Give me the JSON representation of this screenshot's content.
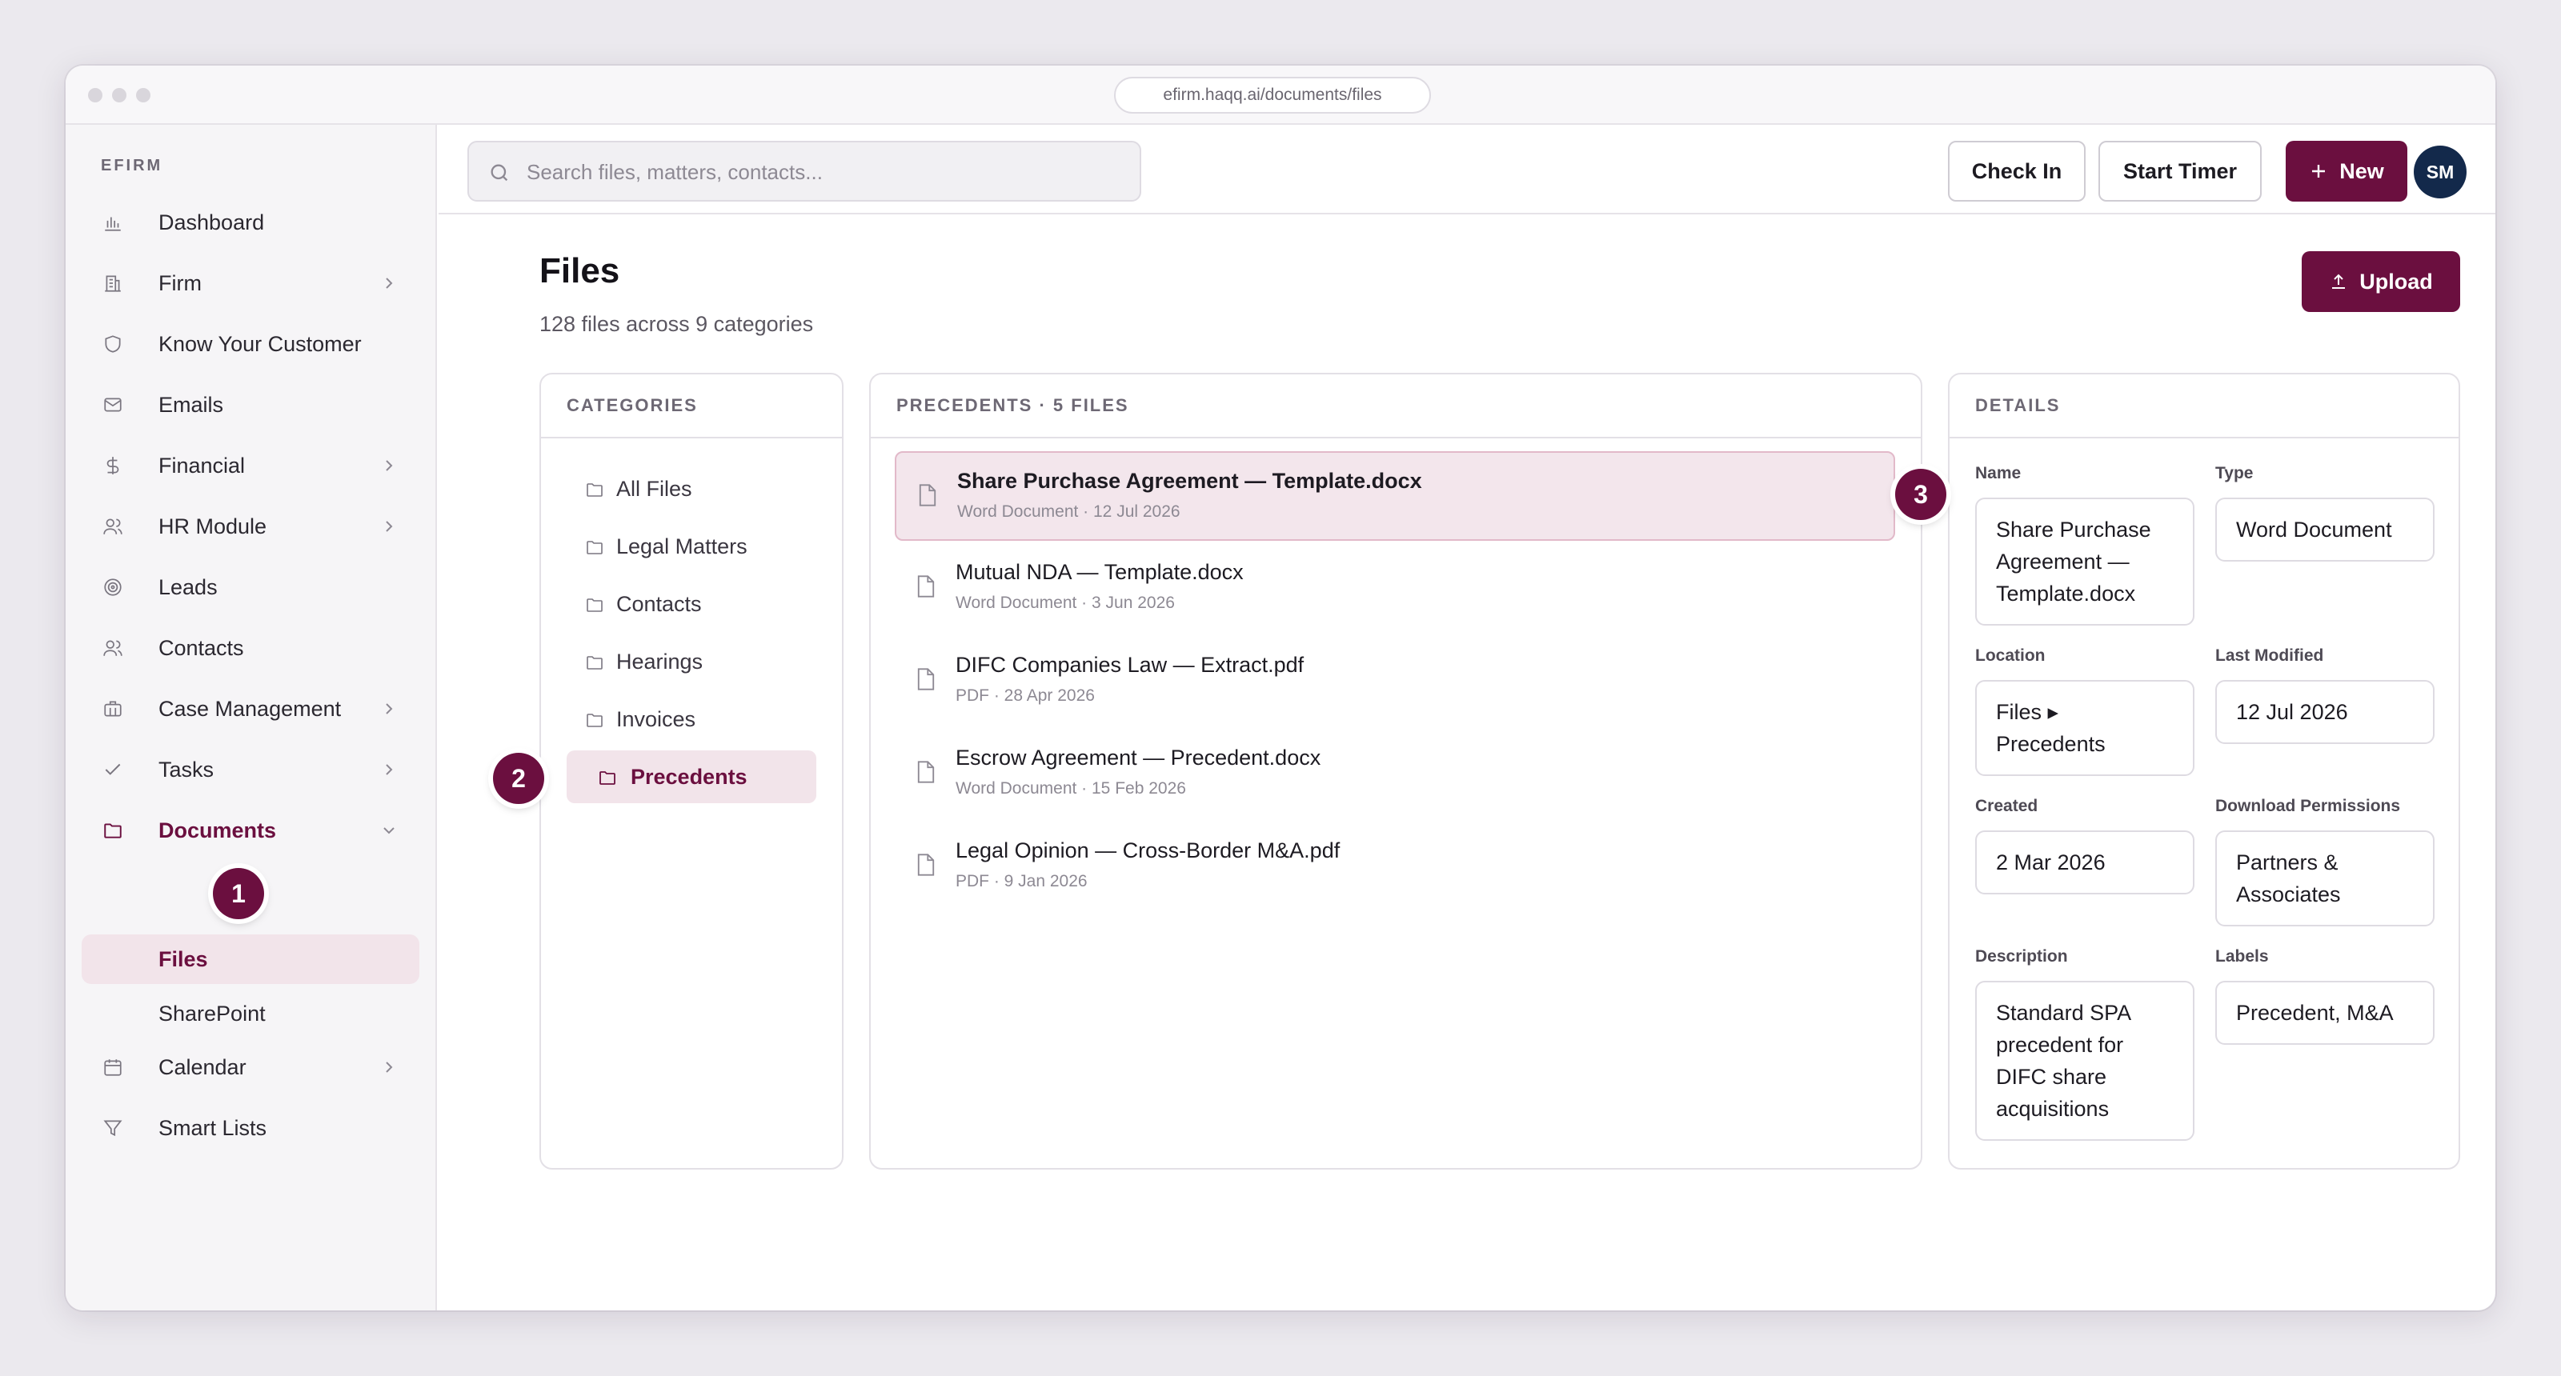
{
  "browser": {
    "url": "efirm.haqq.ai/documents/files"
  },
  "sidebar": {
    "brand": "EFIRM",
    "items": [
      {
        "label": "Dashboard",
        "icon": "bar-chart-icon"
      },
      {
        "label": "Firm",
        "icon": "building-icon",
        "expandable": true
      },
      {
        "label": "Know Your Customer",
        "icon": "shield-icon"
      },
      {
        "label": "Emails",
        "icon": "mail-icon"
      },
      {
        "label": "Financial",
        "icon": "dollar-icon",
        "expandable": true
      },
      {
        "label": "HR Module",
        "icon": "users-icon",
        "expandable": true
      },
      {
        "label": "Leads",
        "icon": "target-icon"
      },
      {
        "label": "Contacts",
        "icon": "users-icon"
      },
      {
        "label": "Case Management",
        "icon": "briefcase-icon",
        "expandable": true
      },
      {
        "label": "Tasks",
        "icon": "check-icon",
        "expandable": true
      },
      {
        "label": "Documents",
        "icon": "folder-icon",
        "expandable": true,
        "active": true
      },
      {
        "label": "Calendar",
        "icon": "calendar-icon",
        "expandable": true
      },
      {
        "label": "Smart Lists",
        "icon": "filter-icon"
      }
    ],
    "sub_items": [
      {
        "label": "Files",
        "active": true
      },
      {
        "label": "SharePoint"
      }
    ]
  },
  "topbar": {
    "search_placeholder": "Search files, matters, contacts...",
    "check_in": "Check In",
    "start_timer": "Start Timer",
    "new": "New",
    "avatar_initials": "SM"
  },
  "page": {
    "title": "Files",
    "subtitle": "128 files across 9 categories",
    "upload": "Upload"
  },
  "categories": {
    "header": "CATEGORIES",
    "items": [
      "All Files",
      "Legal Matters",
      "Contacts",
      "Hearings",
      "Invoices",
      "Precedents"
    ],
    "active": "Precedents"
  },
  "files": {
    "header": "PRECEDENTS · 5 FILES",
    "items": [
      {
        "name": "Share Purchase Agreement — Template.docx",
        "meta": "Word Document · 12 Jul 2026",
        "selected": true
      },
      {
        "name": "Mutual NDA — Template.docx",
        "meta": "Word Document · 3 Jun 2026"
      },
      {
        "name": "DIFC Companies Law — Extract.pdf",
        "meta": "PDF · 28 Apr 2026"
      },
      {
        "name": "Escrow Agreement — Precedent.docx",
        "meta": "Word Document · 15 Feb 2026"
      },
      {
        "name": "Legal Opinion — Cross-Border M&A.pdf",
        "meta": "PDF · 9 Jan 2026"
      }
    ]
  },
  "details": {
    "header": "DETAILS",
    "name_label": "Name",
    "name_value": "Share Purchase Agreement — Template.docx",
    "type_label": "Type",
    "type_value": "Word Document",
    "location_label": "Location",
    "location_value": "Files ▸ Precedents",
    "modified_label": "Last Modified",
    "modified_value": "12 Jul 2026",
    "created_label": "Created",
    "created_value": "2 Mar 2026",
    "permissions_label": "Download Permissions",
    "permissions_value": "Partners & Associates",
    "description_label": "Description",
    "description_value": "Standard SPA precedent for DIFC share acquisitions",
    "labels_label": "Labels",
    "labels_value": "Precedent, M&A"
  },
  "callouts": [
    "1",
    "2",
    "3"
  ],
  "colors": {
    "accent": "#6b0f3f",
    "accent_soft": "#f2e4ea",
    "avatar": "#13294b"
  }
}
